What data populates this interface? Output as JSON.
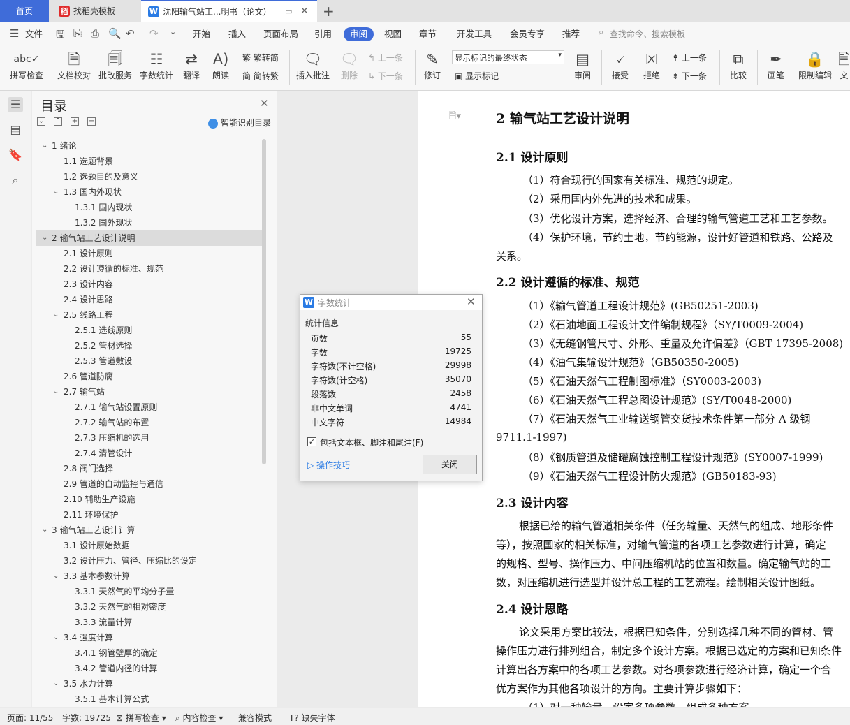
{
  "tabs": {
    "home": "首页",
    "template": "找稻壳模板",
    "doc": "沈阳输气站工...明书（论文）"
  },
  "menu": {
    "file": "文件",
    "items": [
      "开始",
      "插入",
      "页面布局",
      "引用",
      "审阅",
      "视图",
      "章节",
      "开发工具",
      "会员专享",
      "推荐"
    ],
    "active": "审阅",
    "search": "查找命令、搜索模板"
  },
  "ribbon": {
    "spellcheck": "拼写检查",
    "proofread": "文档校对",
    "batch": "批改服务",
    "wordcount": "字数统计",
    "translate": "翻译",
    "read": "朗读",
    "to_trad": "繁转简",
    "to_simp": "简转繁",
    "insert_comment": "插入批注",
    "delete": "删除",
    "prev1": "上一条",
    "next1": "下一条",
    "revise": "修订",
    "markup_mode": "显示标记的最终状态",
    "show_markup": "显示标记",
    "review": "审阅",
    "accept": "接受",
    "reject": "拒绝",
    "prev2": "上一条",
    "next2": "下一条",
    "compare": "比较",
    "pen": "画笔",
    "restrict": "限制编辑",
    "doc_cut": "文"
  },
  "toc": {
    "title": "目录",
    "smart": "智能识别目录",
    "items": [
      {
        "label": "1 绪论",
        "level": 1,
        "chev": "v"
      },
      {
        "label": "1.1 选题背景",
        "level": 2
      },
      {
        "label": "1.2 选题目的及意义",
        "level": 2
      },
      {
        "label": "1.3 国内外现状",
        "level": 2,
        "chev": "v"
      },
      {
        "label": "1.3.1 国内现状",
        "level": 3
      },
      {
        "label": "1.3.2 国外现状",
        "level": 3
      },
      {
        "label": "2 输气站工艺设计说明",
        "level": 1,
        "chev": "v",
        "sel": true
      },
      {
        "label": "2.1 设计原则",
        "level": 2
      },
      {
        "label": "2.2 设计遵循的标准、规范",
        "level": 2
      },
      {
        "label": "2.3 设计内容",
        "level": 2
      },
      {
        "label": "2.4 设计思路",
        "level": 2
      },
      {
        "label": "2.5 线路工程",
        "level": 2,
        "chev": "v"
      },
      {
        "label": "2.5.1 选线原则",
        "level": 3
      },
      {
        "label": "2.5.2 管材选择",
        "level": 3
      },
      {
        "label": "2.5.3 管道敷设",
        "level": 3
      },
      {
        "label": "2.6 管道防腐",
        "level": 2
      },
      {
        "label": "2.7 输气站",
        "level": 2,
        "chev": "v"
      },
      {
        "label": "2.7.1 输气站设置原则",
        "level": 3
      },
      {
        "label": "2.7.2 输气站的布置",
        "level": 3
      },
      {
        "label": "2.7.3 压缩机的选用",
        "level": 3
      },
      {
        "label": "2.7.4 清管设计",
        "level": 3
      },
      {
        "label": "2.8 阀门选择",
        "level": 2
      },
      {
        "label": "2.9 管道的自动监控与通信",
        "level": 2
      },
      {
        "label": "2.10 辅助生产设施",
        "level": 2
      },
      {
        "label": "2.11 环境保护",
        "level": 2
      },
      {
        "label": "3 输气站工艺设计计算",
        "level": 1,
        "chev": "v"
      },
      {
        "label": "3.1 设计原始数据",
        "level": 2
      },
      {
        "label": "3.2 设计压力、管径、压缩比的设定",
        "level": 2
      },
      {
        "label": "3.3 基本参数计算",
        "level": 2,
        "chev": "v"
      },
      {
        "label": "3.3.1 天然气的平均分子量",
        "level": 3
      },
      {
        "label": "3.3.2 天然气的相对密度",
        "level": 3
      },
      {
        "label": "3.3.3 流量计算",
        "level": 3
      },
      {
        "label": "3.4 强度计算",
        "level": 2,
        "chev": "v"
      },
      {
        "label": "3.4.1 钢管壁厚的确定",
        "level": 3
      },
      {
        "label": "3.4.2 管道内径的计算",
        "level": 3
      },
      {
        "label": "3.5 水力计算",
        "level": 2,
        "chev": "v"
      },
      {
        "label": "3.5.1 基本计算公式",
        "level": 3
      }
    ]
  },
  "doc": {
    "h_main": "2 输气站工艺设计说明",
    "h21": "2.1 设计原则",
    "p21_1": "（1）符合现行的国家有关标准、规范的规定。",
    "p21_2": "（2）采用国内外先进的技术和成果。",
    "p21_3": "（3）优化设计方案，选择经济、合理的输气管道工艺和工艺参数。",
    "p21_4": "（4）保护环境，节约土地，节约能源，设计好管道和铁路、公路及",
    "p21_4b": "关系。",
    "h22": "2.2 设计遵循的标准、规范",
    "s1": "（1）《输气管道工程设计规范》(GB50251-2003)",
    "s2": "（2）《石油地面工程设计文件编制规程》（SY/T0009-2004)",
    "s3": "（3）《无缝钢管尺寸、外形、重量及允许偏差》（GBT 17395-2008)",
    "s4": "（4）《油气集输设计规范》（GB50350-2005)",
    "s5": "（5）《石油天然气工程制图标准》（SY0003-2003)",
    "s6": "（6）《石油天然气工程总图设计规范》(SY/T0048-2000)",
    "s7": "（7）《石油天然气工业输送钢管交货技术条件第一部分 A 级钢",
    "s7b": "9711.1-1997)",
    "s8": "（8）《钢质管道及储罐腐蚀控制工程设计规范》(SY0007-1999)",
    "s9": "（9）《石油天然气工程设计防火规范》(GB50183-93)",
    "h23": "2.3 设计内容",
    "p23_1": "根据已给的输气管道相关条件（任务输量、天然气的组成、地形条件",
    "p23_2": "等），按照国家的相关标准，对输气管道的各项工艺参数进行计算，确定",
    "p23_3": "的规格、型号、操作压力、中间压缩机站的位置和数量。确定输气站的工",
    "p23_4": "数，对压缩机进行选型并设计总工程的工艺流程。绘制相关设计图纸。",
    "h24": "2.4 设计思路",
    "p24_1": "论文采用方案比较法，根据已知条件，分别选择几种不同的管材、管",
    "p24_2": "操作压力进行排列组合，制定多个设计方案。根据已选定的方案和已知条件",
    "p24_3": "计算出各方案中的各项工艺参数。对各项参数进行经济计算，确定一个合",
    "p24_4": "优方案作为其他各项设计的方向。主要计算步骤如下：",
    "p24_5": "（1）对一种输量，设定多项参数，组成多种方案"
  },
  "dialog": {
    "title": "字数统计",
    "section": "统计信息",
    "rows": [
      {
        "k": "页数",
        "v": "55"
      },
      {
        "k": "字数",
        "v": "19725"
      },
      {
        "k": "字符数(不计空格)",
        "v": "29998"
      },
      {
        "k": "字符数(计空格)",
        "v": "35070"
      },
      {
        "k": "段落数",
        "v": "2458"
      },
      {
        "k": "非中文单词",
        "v": "4741"
      },
      {
        "k": "中文字符",
        "v": "14984"
      }
    ],
    "checkbox": "包括文本框、脚注和尾注(F)",
    "tips": "操作技巧",
    "close": "关闭"
  },
  "status": {
    "page": "页面: 11/55",
    "words": "字数: 19725",
    "spell": "拼写检查",
    "content": "内容检查",
    "compat": "兼容模式",
    "missing_font": "缺失字体"
  },
  "colors": {
    "accent": "#3f6cd9",
    "wps_blue": "#2a7be4"
  }
}
